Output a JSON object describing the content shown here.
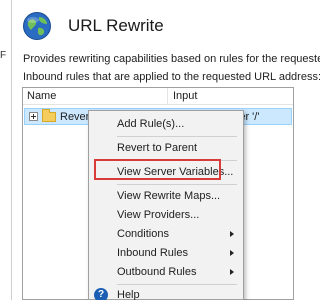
{
  "left": {
    "crumb": "F"
  },
  "header": {
    "title": "URL Rewrite"
  },
  "description": {
    "line1": "Provides rewriting capabilities based on rules for the requested",
    "line2": "Inbound rules that are applied to the requested URL address:"
  },
  "grid": {
    "columns": [
      "Name",
      "Input"
    ],
    "rows": [
      {
        "name": "ReverseProxyInboundR",
        "input": "URL path after '/'"
      }
    ]
  },
  "context_menu": {
    "items": [
      {
        "label": "Add Rule(s)..."
      },
      {
        "label": "Revert to Parent"
      },
      {
        "label": "View Server Variables..."
      },
      {
        "label": "View Rewrite Maps..."
      },
      {
        "label": "View Providers..."
      },
      {
        "label": "Conditions"
      },
      {
        "label": "Inbound Rules"
      },
      {
        "label": "Outbound Rules"
      },
      {
        "label": "Help"
      }
    ]
  },
  "colors": {
    "highlight": "#d93a3a",
    "selection": "#cce8ff",
    "accent": "#1b5fb5"
  }
}
